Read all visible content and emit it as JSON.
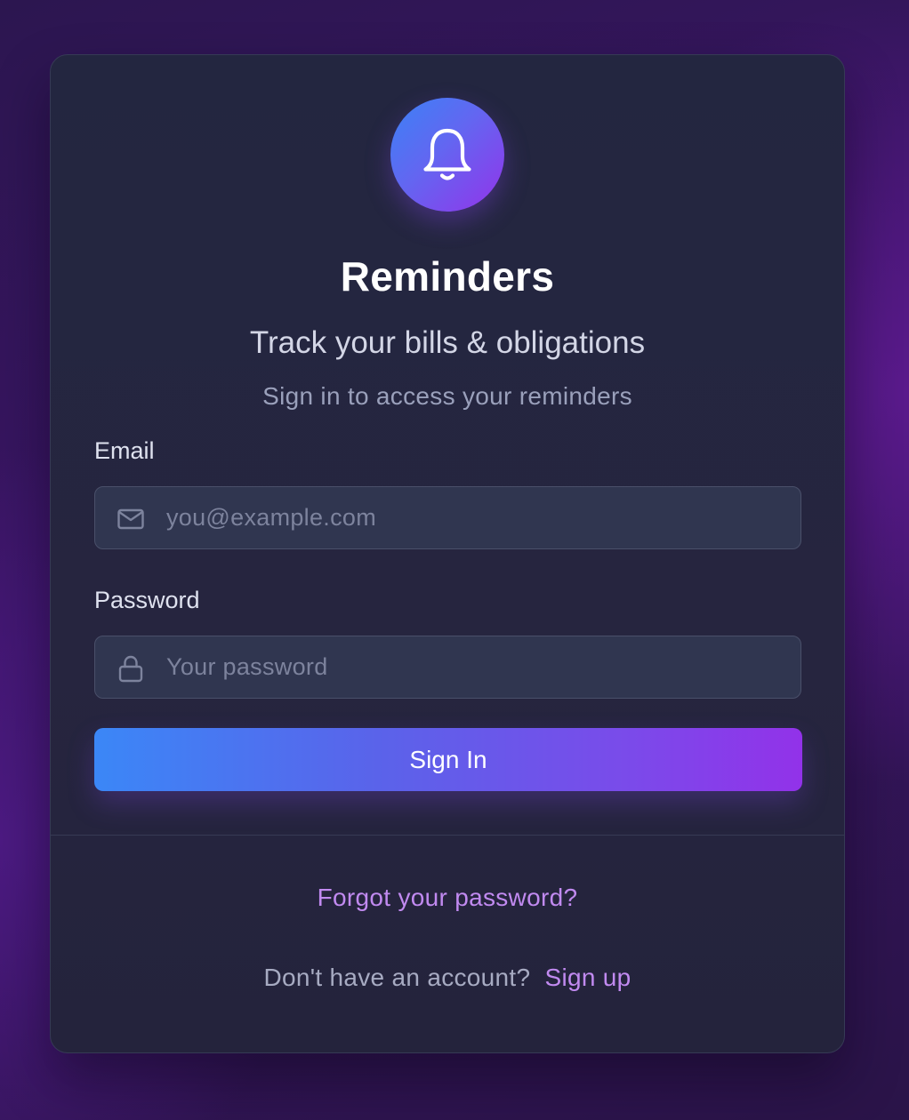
{
  "app": {
    "title": "Reminders",
    "subtitle": "Track your bills & obligations",
    "hint": "Sign in to access your reminders",
    "logo_icon": "bell-icon"
  },
  "form": {
    "email": {
      "label": "Email",
      "placeholder": "you@example.com",
      "value": "",
      "icon": "mail-icon"
    },
    "password": {
      "label": "Password",
      "placeholder": "Your password",
      "value": "",
      "icon": "lock-icon"
    },
    "submit_label": "Sign In"
  },
  "footer": {
    "forgot_label": "Forgot your password?",
    "signup_prompt": "Don't have an account?",
    "signup_label": "Sign up"
  },
  "colors": {
    "accent_start": "#3b82f6",
    "accent_end": "#9333ea",
    "link": "#c18af0",
    "card_bg": "#24263f"
  }
}
